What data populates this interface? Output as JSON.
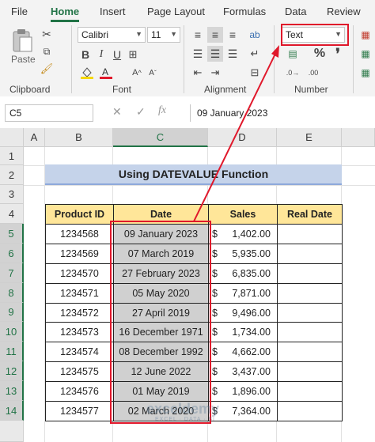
{
  "ribbon": {
    "tabs": [
      "File",
      "Home",
      "Insert",
      "Page Layout",
      "Formulas",
      "Data",
      "Review"
    ],
    "active_tab": "Home",
    "paste_label": "Paste",
    "font_name": "Calibri",
    "font_size": "11",
    "number_format": "Text",
    "groups": {
      "clipboard": "Clipboard",
      "font": "Font",
      "alignment": "Alignment",
      "number": "Number"
    }
  },
  "formula_bar": {
    "name_box": "C5",
    "fx_label": "fx",
    "formula": "09 January 2023"
  },
  "columns": [
    "A",
    "B",
    "C",
    "D",
    "E"
  ],
  "selected_column": "C",
  "rows": [
    "1",
    "2",
    "3",
    "4",
    "5",
    "6",
    "7",
    "8",
    "9",
    "10",
    "11",
    "12",
    "13",
    "14"
  ],
  "sheet": {
    "title": "Using DATEVALUE Function",
    "headers": {
      "product_id": "Product ID",
      "date": "Date",
      "sales": "Sales",
      "real_date": "Real Date"
    },
    "currency_symbol": "$",
    "records": [
      {
        "id": "1234568",
        "date": "09 January 2023",
        "sales": "1,402.00"
      },
      {
        "id": "1234569",
        "date": "07 March 2019",
        "sales": "5,935.00"
      },
      {
        "id": "1234570",
        "date": "27 February 2023",
        "sales": "6,835.00"
      },
      {
        "id": "1234571",
        "date": "05 May 2020",
        "sales": "7,871.00"
      },
      {
        "id": "1234572",
        "date": "27 April 2019",
        "sales": "9,496.00"
      },
      {
        "id": "1234573",
        "date": "16 December 1971",
        "sales": "1,734.00"
      },
      {
        "id": "1234574",
        "date": "08 December 1992",
        "sales": "4,662.00"
      },
      {
        "id": "1234575",
        "date": "12 June 2022",
        "sales": "3,437.00"
      },
      {
        "id": "1234576",
        "date": "01 May 2019",
        "sales": "1,896.00"
      },
      {
        "id": "1234577",
        "date": "02 March 2020",
        "sales": "7,364.00"
      }
    ]
  },
  "watermark": {
    "brand": "exceldemy",
    "tagline": "EXCEL · DATA · BI"
  },
  "colors": {
    "excel_green": "#217346",
    "highlight_red": "#e0182b",
    "header_fill": "#ffe699",
    "banner_fill": "#c5d3ea",
    "selection_fill": "#d0d0d0"
  }
}
